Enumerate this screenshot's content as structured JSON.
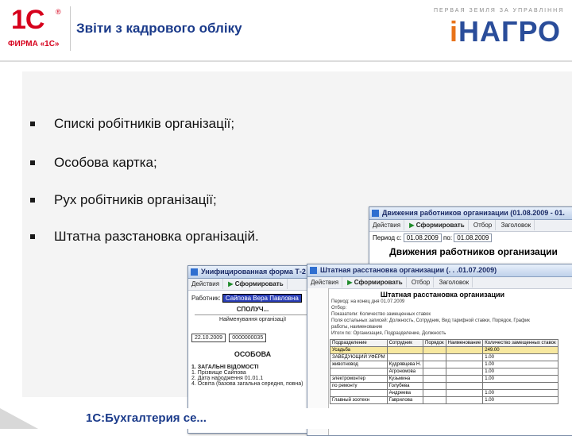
{
  "header": {
    "logo_text": "1С",
    "logo_reg": "®",
    "logo_firm": "ФИРМА «1С»",
    "title": "Звіти з кадрового обліку",
    "brand_tagline": "ПЕРВАЯ ЗЕМЛЯ ЗА УПРАВЛІННЯ",
    "brand_name_i": "і",
    "brand_name_rest": "НАГРО"
  },
  "bullets": [
    "Спискі робітників організації;",
    "Особова картка;",
    "Рух робітників організації;",
    "Штатна разстановка організацій."
  ],
  "footer": {
    "text": "1С:Бухгалтерия се..."
  },
  "windows": {
    "movement": {
      "title": "Движения работников организации (01.08.2009 - 01.",
      "actions_label": "Действия",
      "form_label": "Сформировать",
      "filter_label": "Отбор",
      "settings_label": "Заголовок",
      "period_from_label": "Период с:",
      "period_from": "01.08.2009",
      "period_to_label": "по:",
      "period_to": "01.08.2009",
      "report_title": "Движения работников организации"
    },
    "card": {
      "title": "Унифицированная форма Т-2",
      "actions_label": "Действия",
      "form_label": "Сформировать",
      "employee_label": "Работник:",
      "employee_value": "Сайпова Вера Павловна",
      "caption": "СПОЛУЧ...",
      "subcaption": "Найменування організації",
      "date_value": "22.10.2009",
      "number_value": "0000000035",
      "heading": "ОСОБОВА",
      "section": "1. ЗАГАЛЬНІ ВІДОМОСТІ",
      "field1": "1. Прізвище",
      "field1_value": "Сайпова",
      "field2": "2. Дата народження",
      "field2_value": "01.01.1",
      "field3": "4. Освіта (базова загальна середня, повна)"
    },
    "staff": {
      "title": "Штатная расстановка организации (. . .01.07.2009)",
      "actions_label": "Действия",
      "form_label": "Сформировать",
      "filter_label": "Отбор",
      "settings_label": "Заголовок",
      "report_title": "Штатная расстановка организации",
      "meta": [
        "Период: на конец дня 01.07.2009",
        "Отбор:",
        "Показатели: Количество замещенных ставок",
        "Поля остальных записей: Должность, Сотрудник, Вид тарифной ставки, Порядок, График",
        "работы, наименование",
        "Итоги по: Организация, Подразделение, Должность"
      ],
      "columns": [
        "Подразделение",
        "Сотрудник",
        "Порядок",
        "Наименование",
        "Количество замещенных ставок"
      ],
      "rows": [
        [
          "Усадьба",
          "",
          "",
          "",
          "249.00"
        ],
        [
          "ЗАВЕДУЮЩИЙ УФЕРМ",
          "",
          "",
          "",
          "1.00"
        ],
        [
          "животновод",
          "Кудрявцева Н.",
          "",
          "",
          "1.00"
        ],
        [
          "",
          "Агрономова",
          "",
          "",
          "1.00"
        ],
        [
          "электромонтер",
          "Кузьмина",
          "",
          "",
          "1.00"
        ],
        [
          "по ремонту",
          "Голубева",
          "",
          "",
          ""
        ],
        [
          "",
          "Андреева",
          "",
          "",
          "1.00"
        ],
        [
          "Главный зоотехн",
          "Гаврилова",
          "",
          "",
          "1.00"
        ]
      ]
    }
  }
}
